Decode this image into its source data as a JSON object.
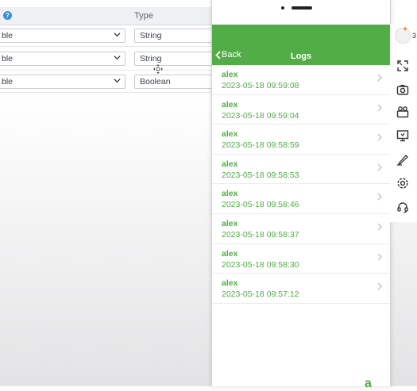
{
  "editor": {
    "help_glyph": "?",
    "type_header": "Type",
    "rows": [
      {
        "field_value": "ble",
        "type": "String"
      },
      {
        "field_value": "ble",
        "type": "String"
      },
      {
        "field_value": "ble",
        "type": "Boolean"
      }
    ]
  },
  "phone": {
    "nav": {
      "back_label": "Back",
      "title": "Logs"
    },
    "logs": [
      {
        "user": "alex",
        "time": "2023-05-18 09:59:08"
      },
      {
        "user": "alex",
        "time": "2023-05-18 09:59:04"
      },
      {
        "user": "alex",
        "time": "2023-05-18 09:58:59"
      },
      {
        "user": "alex",
        "time": "2023-05-18 09:58:53"
      },
      {
        "user": "alex",
        "time": "2023-05-18 09:58:46"
      },
      {
        "user": "alex",
        "time": "2023-05-18 09:58:37"
      },
      {
        "user": "alex",
        "time": "2023-05-18 09:58:30"
      },
      {
        "user": "alex",
        "time": "2023-05-18 09:57:12"
      }
    ],
    "bottom_glyph": "a"
  },
  "toolbar": {
    "edge_label": "3",
    "icons": [
      "avatar-icon",
      "fullscreen-icon",
      "screenshot-icon",
      "record-icon",
      "screen-cast-icon",
      "draw-icon",
      "settings-icon",
      "support-icon"
    ]
  },
  "colors": {
    "accent": "#52ad47",
    "nav_text": "#ffffff"
  }
}
